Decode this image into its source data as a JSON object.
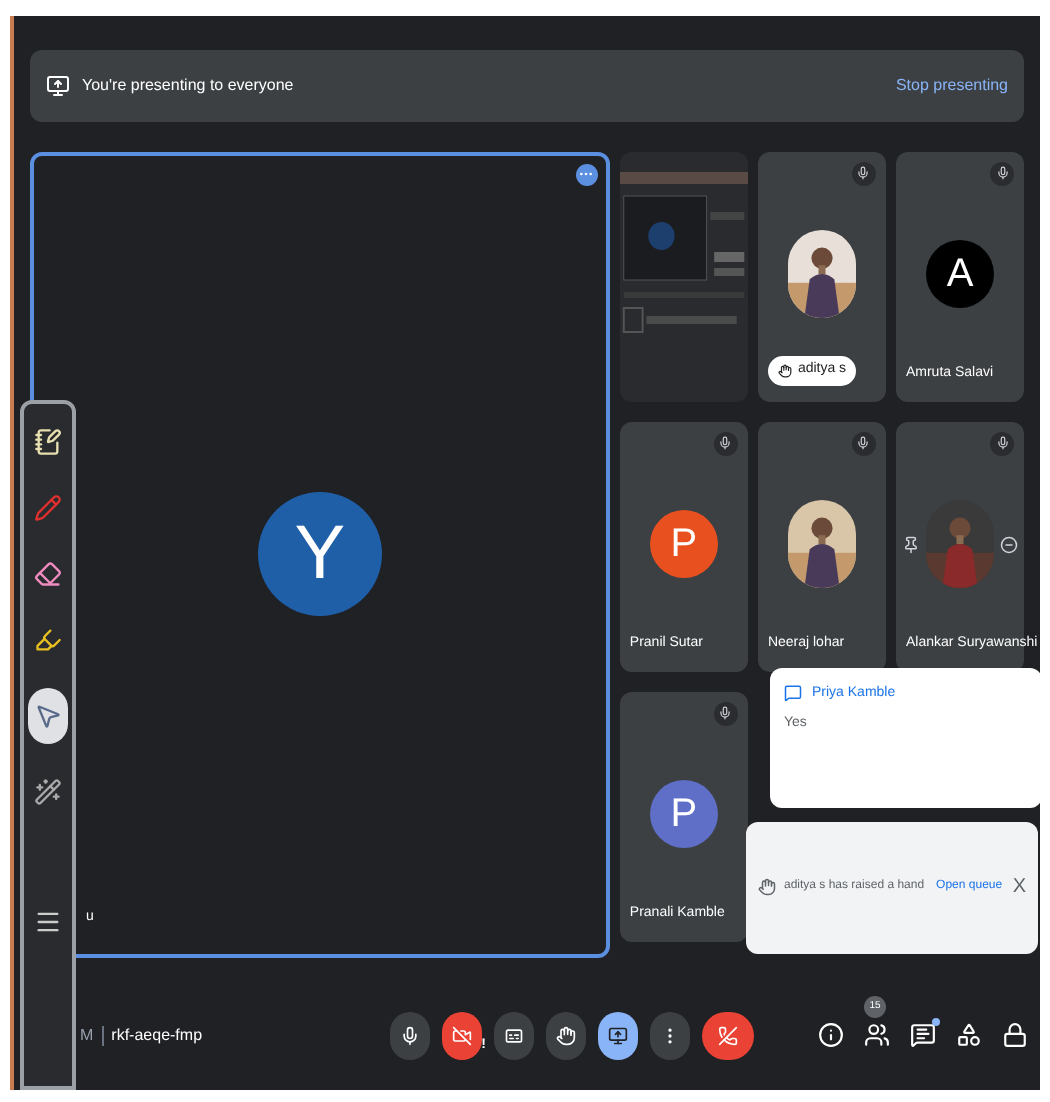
{
  "banner": {
    "text": "You're presenting to everyone",
    "action": "Stop presenting"
  },
  "main_tile": {
    "initial": "Y",
    "name": "u",
    "color": "#1e5fa8"
  },
  "tiles": [
    {
      "kind": "screen"
    },
    {
      "name": "aditya s",
      "hand_raised": true
    },
    {
      "kind": "initial",
      "initial": "A",
      "name": "Amruta Salavi",
      "color": "#000000",
      "hand_raised": false
    },
    {
      "kind": "initial",
      "initial": "P",
      "name": "Pranil Sutar",
      "color": "#e8501f",
      "hand_raised": false
    },
    {
      "name": "Neeraj lohar",
      "hand_raised": false
    },
    {
      "kind": "pinned_photo",
      "name": "Alankar Suryawanshi",
      "hand_raised": false
    },
    {
      "kind": "initial",
      "initial": "P",
      "name": "Pranali Kamble",
      "color": "#5f6fc8",
      "hand_raised": false
    }
  ],
  "chat_popup": {
    "sender": "Priya Kamble",
    "message": "Yes"
  },
  "hand_notice": {
    "text": "aditya s has raised a hand",
    "action": "Open queue",
    "close": "X"
  },
  "pen_toolbar": [
    {
      "kind": "notes",
      "selected": false
    },
    {
      "kind": "pen",
      "selected": false
    },
    {
      "kind": "eraser",
      "selected": false
    },
    {
      "kind": "highlighter",
      "selected": false
    },
    {
      "kind": "pointer",
      "selected": true
    },
    {
      "kind": "laser",
      "selected": false
    },
    {
      "kind": "menu",
      "selected": false
    }
  ],
  "meeting": {
    "time": "M",
    "code": "rkf-aeqe-fmp"
  },
  "controls": [
    {
      "kind": "mic",
      "on": true
    },
    {
      "kind": "camera",
      "on": false,
      "alert": "!"
    },
    {
      "kind": "captions",
      "on": false
    },
    {
      "kind": "hand",
      "on": false
    },
    {
      "kind": "present",
      "on": true
    },
    {
      "kind": "more"
    },
    {
      "kind": "end"
    }
  ],
  "side_controls": [
    {
      "kind": "info"
    },
    {
      "kind": "people",
      "count": "15"
    },
    {
      "kind": "chat",
      "unread": true
    },
    {
      "kind": "activities"
    },
    {
      "kind": "lock"
    }
  ]
}
